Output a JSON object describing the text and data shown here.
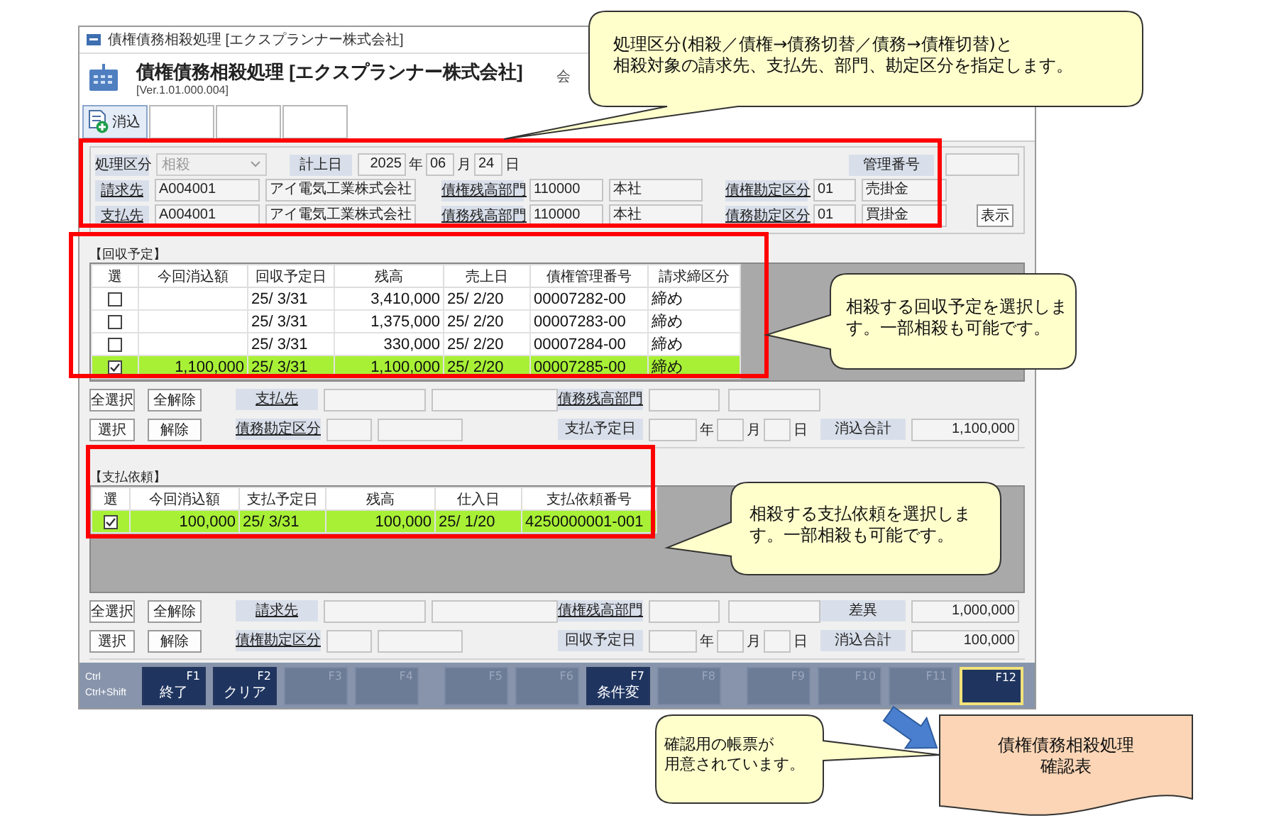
{
  "window": {
    "title": "債権債務相殺処理 [エクスプランナー株式会社]"
  },
  "header": {
    "title": "債権債務相殺処理 [エクスプランナー株式会社]",
    "version": "[Ver.1.01.000.004]",
    "company_label": "会"
  },
  "toolbar": [
    {
      "kind": "action",
      "label": "消込"
    },
    {
      "kind": "blank"
    },
    {
      "kind": "blank"
    },
    {
      "kind": "blank"
    }
  ],
  "conditions": {
    "processing_type": {
      "label": "処理区分",
      "value": "相殺",
      "disabled": true
    },
    "posting_date": {
      "label": "計上日",
      "year": "2025",
      "year_unit": "年",
      "month": "06",
      "month_unit": "月",
      "day": "24",
      "day_unit": "日"
    },
    "management_number": {
      "label": "管理番号"
    },
    "rows": [
      {
        "party": {
          "label": "請求先",
          "code": "A004001",
          "name": "アイ電気工業株式会社"
        },
        "department": {
          "label": "債権残高部門",
          "code": "110000",
          "name": "本社"
        },
        "account": {
          "label": "債権勘定区分",
          "code": "01",
          "name": "売掛金"
        }
      },
      {
        "party": {
          "label": "支払先",
          "code": "A004001",
          "name": "アイ電気工業株式会社"
        },
        "department": {
          "label": "債務残高部門",
          "code": "110000",
          "name": "本社"
        },
        "account": {
          "label": "債務勘定区分",
          "code": "01",
          "name": "買掛金"
        }
      }
    ],
    "show_button": "表示"
  },
  "receivables": {
    "title": "【回収予定】",
    "columns": [
      "選",
      "今回消込額",
      "回収予定日",
      "残高",
      "売上日",
      "債権管理番号",
      "請求締区分"
    ],
    "rows": [
      {
        "selected": false,
        "due": "25/ 3/31",
        "balance": "3,410,000",
        "date": "25/ 2/20",
        "number": "00007282-00",
        "closing": "締め"
      },
      {
        "selected": false,
        "due": "25/ 3/31",
        "balance": "1,375,000",
        "date": "25/ 2/20",
        "number": "00007283-00",
        "closing": "締め"
      },
      {
        "selected": false,
        "due": "25/ 3/31",
        "balance": "330,000",
        "date": "25/ 2/20",
        "number": "00007284-00",
        "closing": "締め"
      },
      {
        "selected": true,
        "amount": "1,100,000",
        "due": "25/ 3/31",
        "balance": "1,100,000",
        "date": "25/ 2/20",
        "number": "00007285-00",
        "closing": "締め"
      }
    ]
  },
  "receivable_controls": {
    "buttons": [
      "全選択",
      "全解除",
      "選択",
      "解除"
    ],
    "party_label": "支払先",
    "account_label": "債務勘定区分",
    "department_label": "債務残高部門",
    "date": {
      "label": "支払予定日",
      "year_unit": "年",
      "month_unit": "月",
      "day_unit": "日"
    },
    "total": {
      "label": "消込合計",
      "value": "1,100,000"
    }
  },
  "payments": {
    "title": "【支払依頼】",
    "columns": [
      "選",
      "今回消込額",
      "支払予定日",
      "残高",
      "仕入日",
      "支払依頼番号"
    ],
    "rows": [
      {
        "selected": true,
        "amount": "100,000",
        "due": "25/ 3/31",
        "balance": "100,000",
        "date": "25/ 1/20",
        "number": "4250000001-001"
      }
    ]
  },
  "payment_controls": {
    "buttons": [
      "全選択",
      "全解除",
      "選択",
      "解除"
    ],
    "party_label": "請求先",
    "account_label": "債権勘定区分",
    "department_label": "債権残高部門",
    "date": {
      "label": "回収予定日",
      "year_unit": "年",
      "month_unit": "月",
      "day_unit": "日"
    },
    "difference": {
      "label": "差異",
      "value": "1,000,000"
    },
    "total": {
      "label": "消込合計",
      "value": "100,000"
    }
  },
  "function_keys": {
    "modifiers": [
      "Ctrl",
      "Ctrl+Shift"
    ],
    "keys": [
      {
        "key": "F1",
        "label": "終了",
        "disabled": false,
        "selected": false
      },
      {
        "key": "F2",
        "label": "クリア",
        "disabled": false,
        "selected": false
      },
      {
        "key": "F3",
        "disabled": true,
        "selected": false
      },
      {
        "key": "F4",
        "disabled": true,
        "selected": false
      },
      {
        "key": "F5",
        "disabled": true,
        "selected": false
      },
      {
        "key": "F6",
        "disabled": true,
        "selected": false
      },
      {
        "key": "F7",
        "label": "条件変",
        "disabled": false,
        "selected": false
      },
      {
        "key": "F8",
        "disabled": true,
        "selected": false
      },
      {
        "key": "F9",
        "disabled": true,
        "selected": false
      },
      {
        "key": "F10",
        "disabled": true,
        "selected": false
      },
      {
        "key": "F11",
        "disabled": true,
        "selected": false
      },
      {
        "key": "F12",
        "disabled": false,
        "selected": true
      }
    ]
  },
  "callouts": [
    {
      "lines": [
        "処理区分(相殺／債権→債務切替／債務→債権切替)と",
        "相殺対象の請求先、支払先、部門、勘定区分を指定します。"
      ]
    },
    {
      "lines": [
        "相殺する回収予定を選択します。一部相殺も可能です。"
      ]
    },
    {
      "lines": [
        "相殺する支払依頼を選択します。一部相殺も可能です。"
      ]
    },
    {
      "lines": [
        "確認用の帳票が",
        "用意されています。"
      ]
    }
  ],
  "document": {
    "lines": [
      "債権債務相殺処理",
      "確認表"
    ]
  }
}
